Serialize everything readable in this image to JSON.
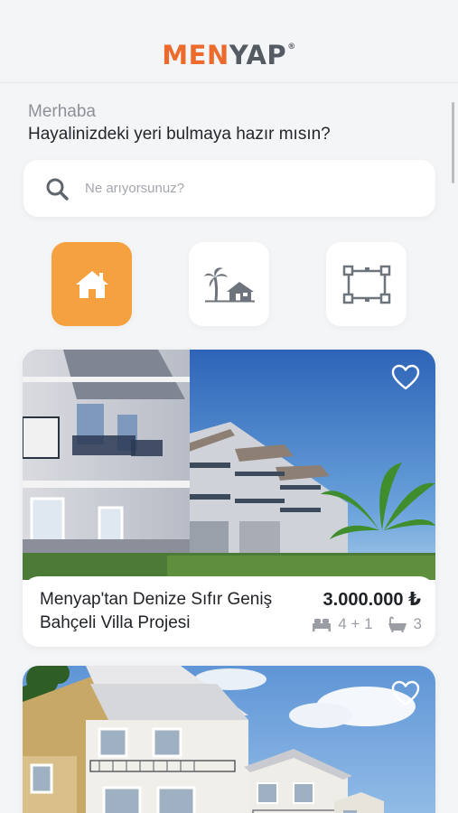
{
  "brand": {
    "men": "MEN",
    "yap": "YAP",
    "reg": "®"
  },
  "greeting": {
    "hello": "Merhaba",
    "question": "Hayalinizdeki yeri bulmaya hazır mısın?"
  },
  "search": {
    "placeholder": "Ne arıyorsunuz?"
  },
  "categories": [
    {
      "icon": "house-icon",
      "active": true
    },
    {
      "icon": "villa-palm-icon",
      "active": false
    },
    {
      "icon": "floor-plan-icon",
      "active": false
    }
  ],
  "listings": [
    {
      "title": "Menyap'tan Denize Sıfır Geniş Bahçeli Villa Projesi",
      "price": "3.000.000 ₺",
      "rooms": "4 + 1",
      "baths": "3"
    },
    {}
  ],
  "colors": {
    "accent": "#f5a13f",
    "brand_orange": "#ec6a2c",
    "brand_gray": "#555b63"
  }
}
